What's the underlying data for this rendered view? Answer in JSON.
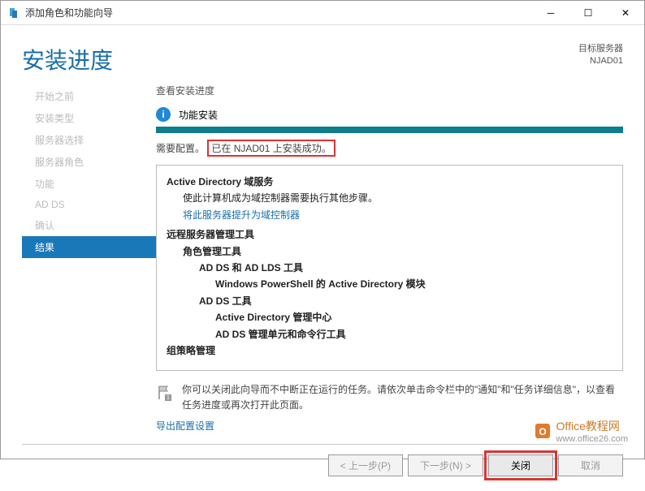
{
  "window": {
    "title": "添加角色和功能向导",
    "min": "─",
    "max": "☐",
    "close": "✕"
  },
  "header": {
    "title": "安装进度",
    "target_label": "目标服务器",
    "target_value": "NJAD01"
  },
  "sidebar": {
    "items": [
      {
        "label": "开始之前"
      },
      {
        "label": "安装类型"
      },
      {
        "label": "服务器选择"
      },
      {
        "label": "服务器角色"
      },
      {
        "label": "功能"
      },
      {
        "label": "AD DS"
      },
      {
        "label": "确认"
      },
      {
        "label": "结果"
      }
    ]
  },
  "main": {
    "heading": "查看安装进度",
    "info_label": "功能安装",
    "status_prefix": "需要配置。",
    "status_highlight": "已在 NJAD01 上安装成功。",
    "panel": {
      "ad_title": "Active Directory 域服务",
      "ad_desc": "使此计算机成为域控制器需要执行其他步骤。",
      "ad_link": "将此服务器提升为域控制器",
      "rsat_title": "远程服务器管理工具",
      "role_tools": "角色管理工具",
      "adds_lds": "AD DS 和 AD LDS 工具",
      "ps_module": "Windows PowerShell 的 Active Directory 模块",
      "adds_tools": "AD DS 工具",
      "ad_center": "Active Directory 管理中心",
      "ad_snapins": "AD DS 管理单元和命令行工具",
      "gpm": "组策略管理"
    },
    "hint": "你可以关闭此向导而不中断正在运行的任务。请依次单击命令栏中的\"通知\"和\"任务详细信息\"，以查看任务进度或再次打开此页面。",
    "export_link": "导出配置设置"
  },
  "footer": {
    "prev": "< 上一步(P)",
    "next": "下一步(N) >",
    "close": "关闭",
    "cancel": "取消"
  },
  "watermark": {
    "brand": "Office教程网",
    "url": "www.office26.com"
  }
}
